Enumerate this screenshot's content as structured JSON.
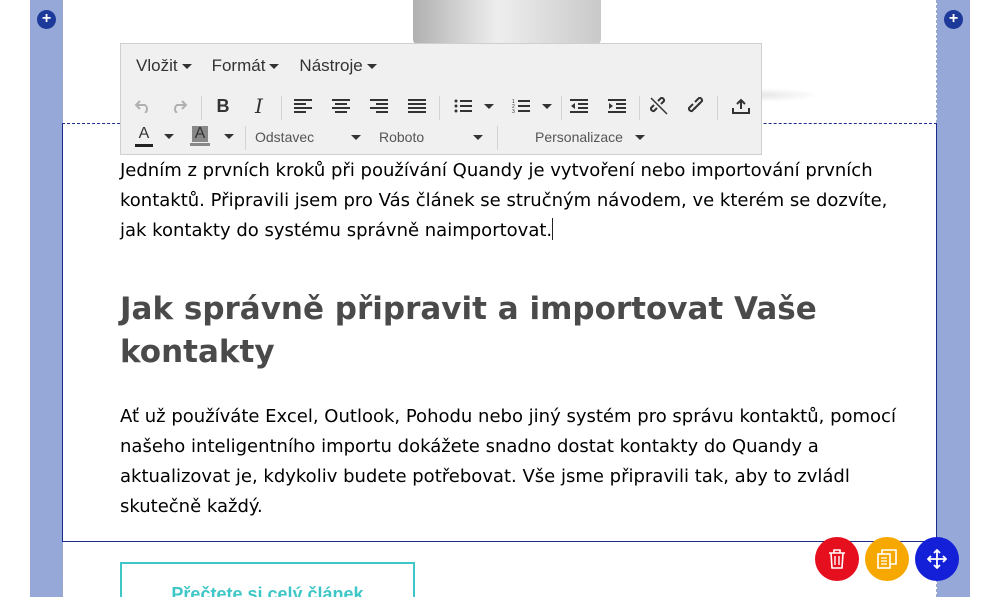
{
  "toolbar": {
    "menus": [
      "Vložit",
      "Formát",
      "Nástroje"
    ],
    "block_format": "Odstavec",
    "font_family": "Roboto",
    "personalize": "Personalizace",
    "text_color_letter": "A",
    "bg_color_letter": "A"
  },
  "content": {
    "paragraph1": "Jedním z prvních kroků při používání Quandy je vytvoření nebo importování prvních kontaktů. Připravili jsem pro Vás článek se stručným návodem, ve kterém se dozvíte, jak kontakty do systému správně naimportovat.",
    "heading": "Jak správně připravit a importovat Vaše kontakty",
    "paragraph2": "Ať už používáte Excel, Outlook, Pohodu nebo jiný systém pro správu kontaktů, pomocí našeho inteligentního importu dokážete snadno dostat kontakty do Quandy a aktualizovat je, kdykoliv budete potřebovat. Vše jsme připravili tak, aby to zvládl skutečně každý.",
    "cta_label": "Přečtete si celý článek"
  },
  "colors": {
    "side_strip": "#95a8d7",
    "cta_accent": "#3fc6c6",
    "delete": "#e60f1e",
    "copy": "#f7a800",
    "move": "#1420d8"
  },
  "icons": {
    "add_left": "plus-circle-icon",
    "add_right": "plus-circle-icon",
    "delete": "trash-icon",
    "copy": "copy-icon",
    "move": "move-arrows-icon"
  }
}
